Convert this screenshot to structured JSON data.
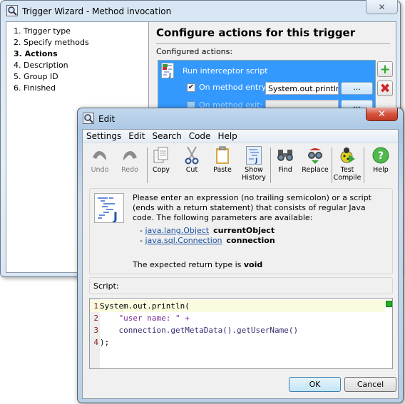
{
  "wizard": {
    "title": "Trigger Wizard - Method invocation",
    "close_label": "✕",
    "steps": [
      {
        "label": "1. Trigger type",
        "active": false
      },
      {
        "label": "2. Specify methods",
        "active": false
      },
      {
        "label": "3. Actions",
        "active": true
      },
      {
        "label": "4. Description",
        "active": false
      },
      {
        "label": "5. Group ID",
        "active": false
      },
      {
        "label": "6. Finished",
        "active": false
      }
    ],
    "panel_title": "Configure actions for this trigger",
    "configured_label": "Configured actions:",
    "action": {
      "name": "Run interceptor script",
      "entry_label": "On method entry:",
      "entry_checked": true,
      "entry_value": "System.out.println(",
      "exit_label": "On method exit:",
      "exit_checked": false,
      "browse_label": "..."
    },
    "add_icon": "+",
    "remove_icon": "✖"
  },
  "edit": {
    "title": "Edit",
    "close_label": "✕",
    "menu": [
      "Settings",
      "Edit",
      "Search",
      "Code",
      "Help"
    ],
    "toolbar": [
      {
        "label": "Undo",
        "icon": "undo-icon",
        "disabled": true
      },
      {
        "label": "Redo",
        "icon": "redo-icon",
        "disabled": true
      },
      {
        "label": "Copy",
        "icon": "copy-icon",
        "disabled": false
      },
      {
        "label": "Cut",
        "icon": "cut-icon",
        "disabled": false
      },
      {
        "label": "Paste",
        "icon": "paste-icon",
        "disabled": false
      },
      {
        "label": "Show History",
        "icon": "history-icon",
        "disabled": false
      },
      {
        "label": "Find",
        "icon": "find-icon",
        "disabled": false
      },
      {
        "label": "Replace",
        "icon": "replace-icon",
        "disabled": false
      },
      {
        "label": "Test Compile",
        "icon": "compile-icon",
        "disabled": false
      },
      {
        "label": "Help",
        "icon": "help-icon",
        "disabled": false
      }
    ],
    "info_text": "Please enter an expression (no trailing semicolon) or a script (ends with a return statement) that consists of regular Java code. The following parameters are available:",
    "params": [
      {
        "type": "java.lang.Object",
        "name": "currentObject"
      },
      {
        "type": "java.sql.Connection",
        "name": "connection"
      }
    ],
    "return_prefix": "The expected return type is ",
    "return_type": "void",
    "script_label": "Script:",
    "code_lines": [
      {
        "num": "1",
        "text": "System.out.println("
      },
      {
        "num": "2",
        "text": "    \"user name: \" +"
      },
      {
        "num": "3",
        "text": "    connection.getMetaData().getUserName()"
      },
      {
        "num": "4",
        "text": ");"
      }
    ],
    "ok_label": "OK",
    "cancel_label": "Cancel"
  }
}
